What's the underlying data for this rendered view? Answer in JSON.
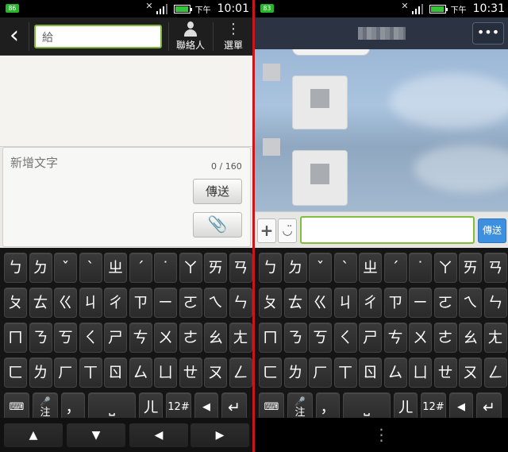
{
  "left": {
    "status": {
      "notification_badge": "86",
      "ampm": "下午",
      "time": "10:01"
    },
    "header": {
      "back_icon": "back-arrow-icon",
      "to_placeholder": "給",
      "contacts_label": "聯絡人",
      "menu_label": "選單"
    },
    "compose": {
      "placeholder": "新增文字",
      "counter": "0 / 160",
      "send_label": "傳送",
      "attach_icon": "paperclip-icon"
    },
    "nav_keys": [
      "▲",
      "▼",
      "◀",
      "▶"
    ]
  },
  "right": {
    "status": {
      "notification_badge": "83",
      "ampm": "下午",
      "time": "10:31"
    },
    "header": {
      "more_label": "•••"
    },
    "input_bar": {
      "plus_label": "+",
      "emoji_label": "◡̈",
      "send_label": "傳送"
    },
    "nav_dots": "⋮"
  },
  "keyboard": {
    "rows": [
      [
        "ㄅ",
        "ㄉ",
        "ˇ",
        "ˋ",
        "ㄓ",
        "ˊ",
        "˙",
        "ㄚ",
        "ㄞ",
        "ㄢ"
      ],
      [
        "ㄆ",
        "ㄊ",
        "ㄍ",
        "ㄐ",
        "ㄔ",
        "ㄗ",
        "ㄧ",
        "ㄛ",
        "ㄟ",
        "ㄣ"
      ],
      [
        "ㄇ",
        "ㄋ",
        "ㄎ",
        "ㄑ",
        "ㄕ",
        "ㄘ",
        "ㄨ",
        "ㄜ",
        "ㄠ",
        "ㄤ"
      ],
      [
        "ㄈ",
        "ㄌ",
        "ㄏ",
        "ㄒ",
        "ㄖ",
        "ㄙ",
        "ㄩ",
        "ㄝ",
        "ㄡ",
        "ㄥ"
      ]
    ],
    "bottom": {
      "keyboard_icon": "⌨",
      "mic_sub": "注",
      "comma": "，",
      "dot": "。",
      "space": "⎵",
      "er": "ㄦ",
      "num": "12#",
      "backspace": "◀",
      "enter": "↵"
    }
  }
}
